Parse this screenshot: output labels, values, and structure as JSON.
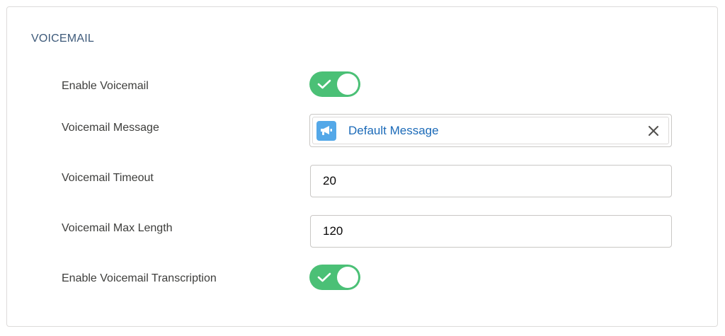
{
  "section": {
    "title": "VOICEMAIL"
  },
  "fields": {
    "enable_voicemail": {
      "label": "Enable Voicemail",
      "checked": true
    },
    "voicemail_message": {
      "label": "Voicemail Message",
      "value": "Default Message",
      "icon": "megaphone-icon"
    },
    "voicemail_timeout": {
      "label": "Voicemail Timeout",
      "value": "20"
    },
    "voicemail_max_length": {
      "label": "Voicemail Max Length",
      "value": "120"
    },
    "enable_transcription": {
      "label": "Enable Voicemail Transcription",
      "checked": true
    }
  },
  "colors": {
    "toggle_on": "#4bc076",
    "link": "#1b6ab8",
    "message_icon_bg": "#54a8e8",
    "section_title": "#3e5a7a"
  }
}
